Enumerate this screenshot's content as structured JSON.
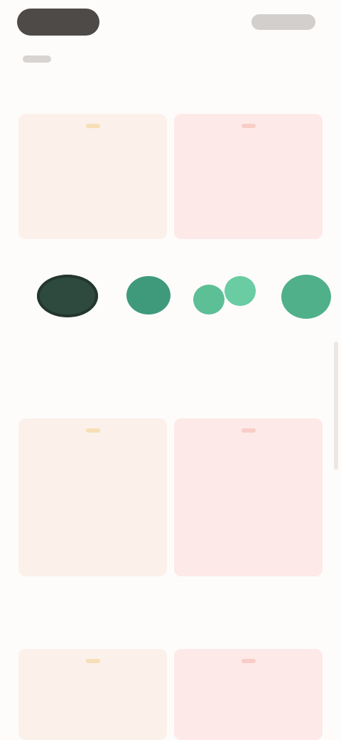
{
  "header": {
    "primary_button_label": "",
    "secondary_link_label": "",
    "back_label": ""
  },
  "sections": [
    {
      "title": "",
      "pros_label": "",
      "cons_label": "",
      "pros": [],
      "cons": []
    },
    {
      "title": "",
      "pros_label": "",
      "cons_label": "",
      "pros": [],
      "cons": []
    },
    {
      "title": "",
      "pros_label": "",
      "cons_label": "",
      "pros": [],
      "cons": []
    }
  ],
  "products": [
    {
      "name": "",
      "lens_color": "#2e4a3f"
    },
    {
      "name": "",
      "lens_color": "#3f9a7c"
    },
    {
      "name": "",
      "lens_color": "#5cbf96"
    },
    {
      "name": "",
      "lens_color": "#4fb089"
    }
  ],
  "colors": {
    "background": "#fdfcfb",
    "pros_card": "#fbf1ea",
    "cons_card": "#fde9e7",
    "pros_badge": "#f6dfb7",
    "cons_badge": "#f8cdc8",
    "button": "#4d4a47"
  }
}
